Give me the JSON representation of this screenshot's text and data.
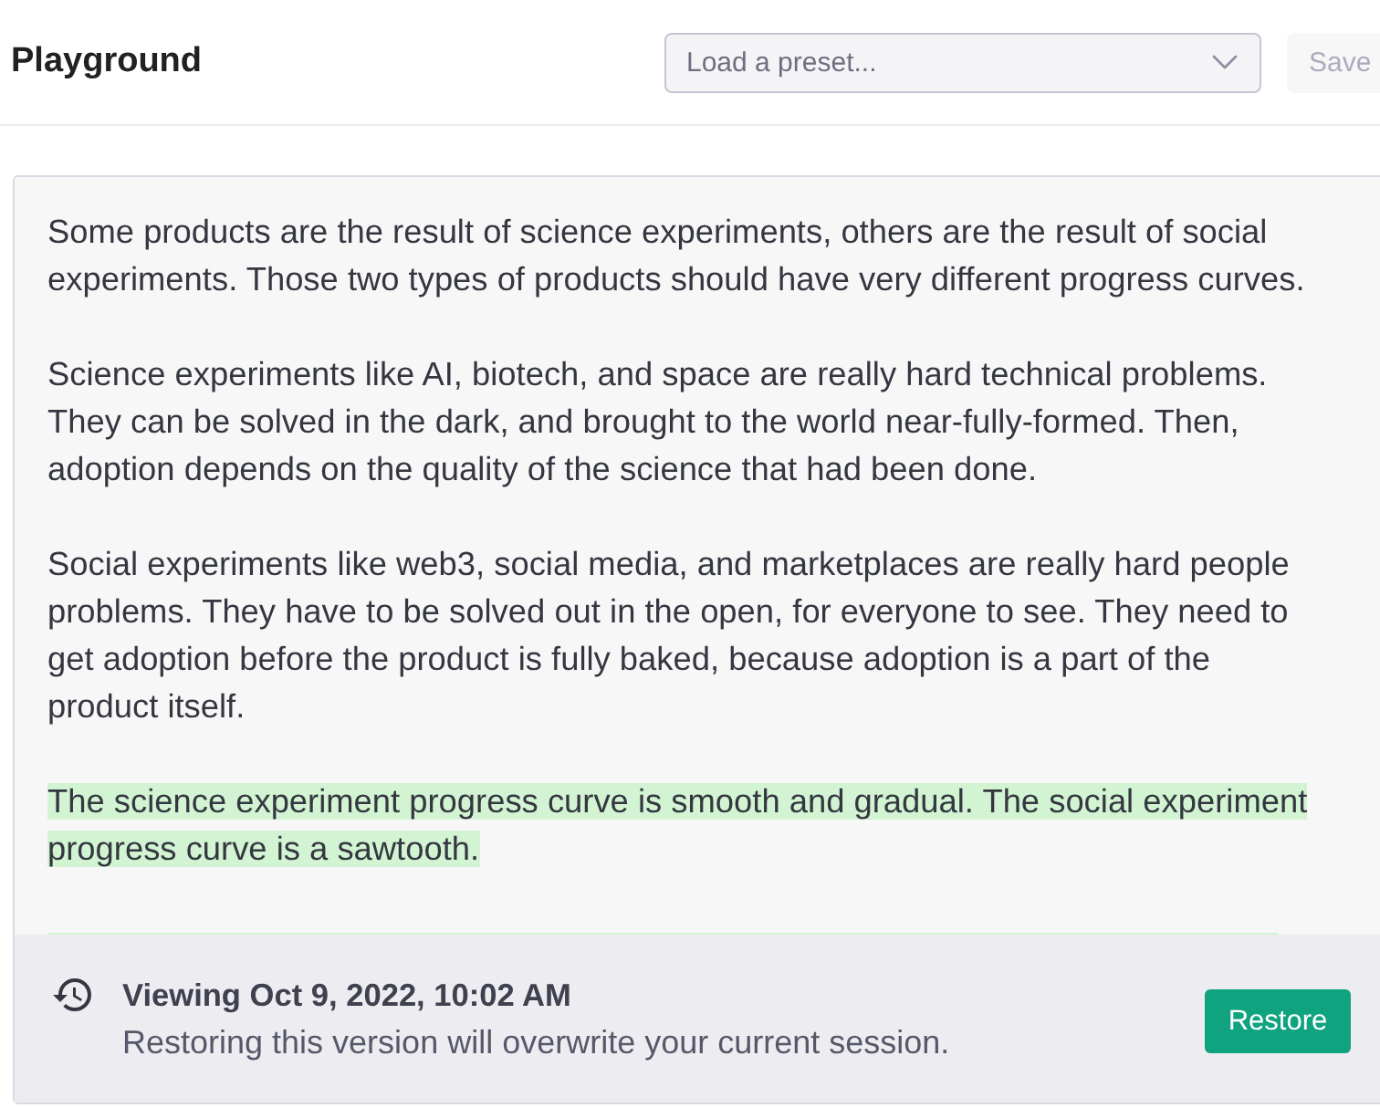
{
  "header": {
    "title": "Playground",
    "preset_select": {
      "placeholder": "Load a preset..."
    },
    "save_button": {
      "label": "Save",
      "disabled": true
    }
  },
  "editor": {
    "paragraphs": [
      {
        "text": "Some products are the result of science experiments, others are the result of social experiments. Those two types of products should have very different progress curves.",
        "highlighted": false
      },
      {
        "text": "Science experiments like AI, biotech, and space are really hard technical problems. They can be solved in the dark, and brought to the world near-fully-formed. Then, adoption depends on the quality of the science that had been done.",
        "highlighted": false
      },
      {
        "text": "Social experiments like web3, social media, and marketplaces are really hard people problems. They have to be solved out in the open, for everyone to see. They need to get adoption before the product is fully baked, because adoption is a part of the product itself.",
        "highlighted": false
      },
      {
        "text": "The science experiment progress curve is smooth and gradual. The social experiment progress curve is a sawtooth.",
        "highlighted": true
      }
    ]
  },
  "history_banner": {
    "title": "Viewing Oct 9, 2022, 10:02 AM",
    "message": "Restoring this version will overwrite your current session.",
    "restore_button": {
      "label": "Restore"
    }
  }
}
